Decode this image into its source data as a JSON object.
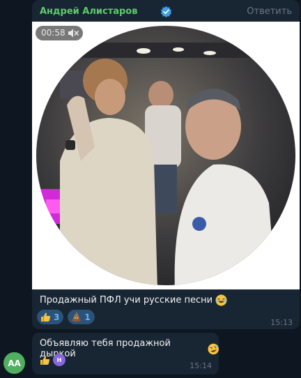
{
  "message1": {
    "author": "Андрей Алистаров",
    "reply_label": "Ответить",
    "video_duration": "00:58",
    "text": "Продажный ПФЛ учи русские песни",
    "reactions": [
      {
        "icon": "thumbs-up",
        "count": "3"
      },
      {
        "icon": "poop",
        "count": "1"
      }
    ],
    "time": "15:13"
  },
  "message2": {
    "text": "Объявляю тебя продажной дыркой",
    "reaction_avatar_initial": "Н",
    "time": "15:14"
  },
  "sender_avatar": "АА",
  "colors": {
    "background": "#0e1621",
    "bubble": "#182533",
    "author_name": "#5fcb6b",
    "reaction_bg": "#2b5278",
    "reaction_count": "#6ab3f3",
    "avatar_bg": "#4fb060"
  }
}
